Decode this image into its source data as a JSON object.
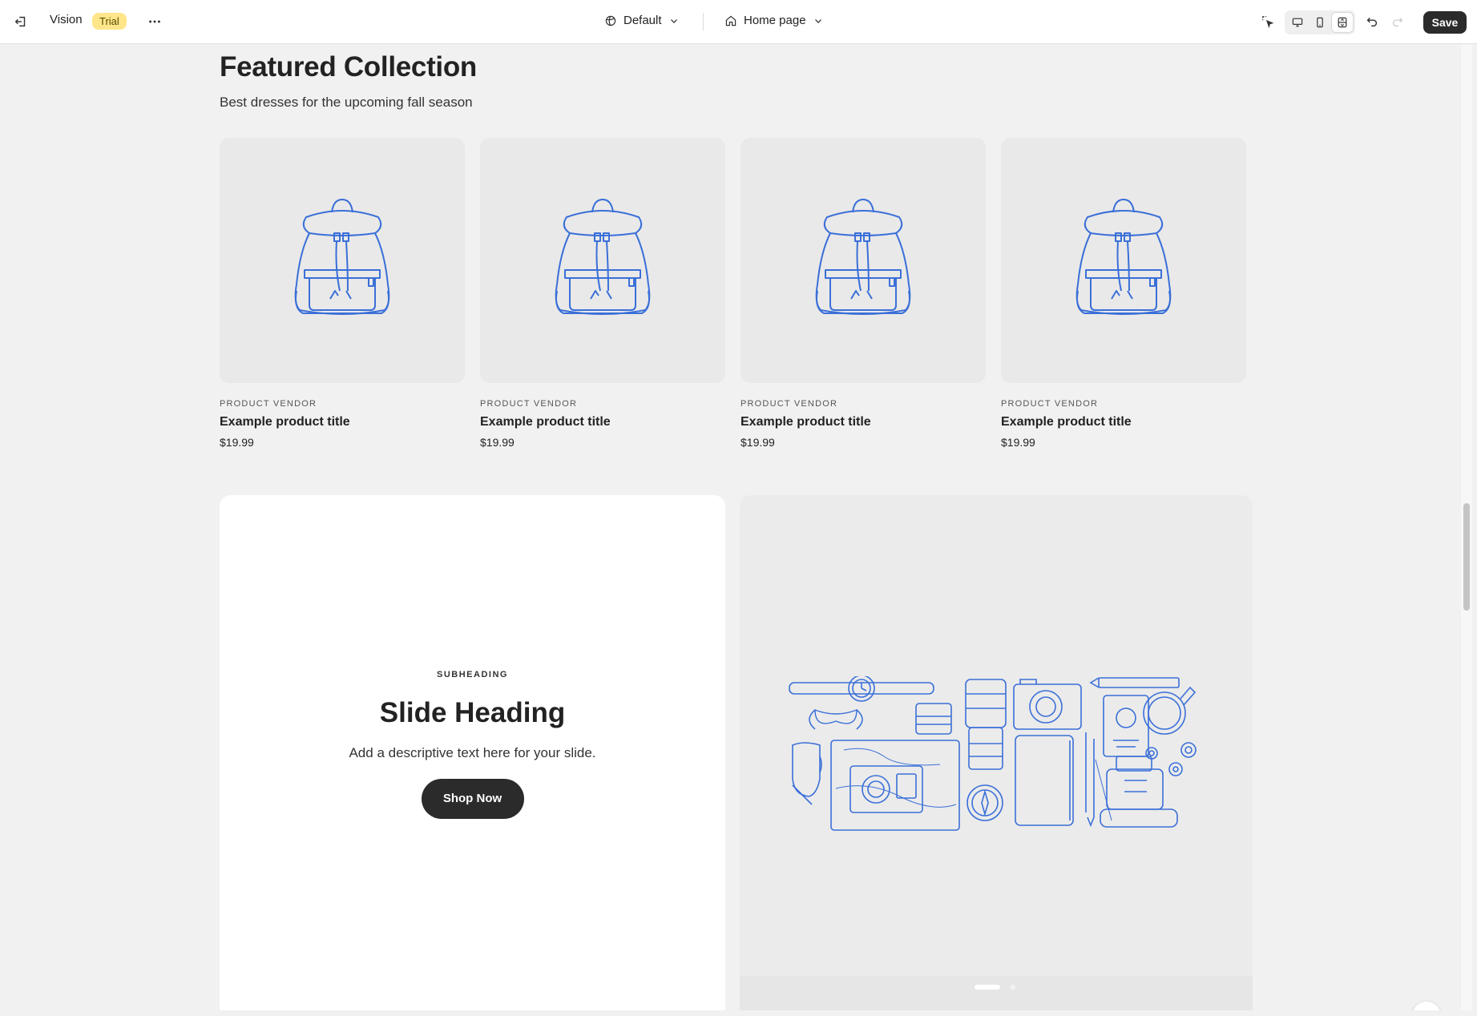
{
  "topbar": {
    "store_name": "Vision",
    "badge": "Trial",
    "theme_dropdown": "Default",
    "page_dropdown": "Home page",
    "save_label": "Save"
  },
  "featured_collection": {
    "title": "Featured Collection",
    "subtitle": "Best dresses for the upcoming fall season",
    "products": [
      {
        "vendor": "PRODUCT VENDOR",
        "title": "Example product title",
        "price": "$19.99"
      },
      {
        "vendor": "PRODUCT VENDOR",
        "title": "Example product title",
        "price": "$19.99"
      },
      {
        "vendor": "PRODUCT VENDOR",
        "title": "Example product title",
        "price": "$19.99"
      },
      {
        "vendor": "PRODUCT VENDOR",
        "title": "Example product title",
        "price": "$19.99"
      }
    ]
  },
  "slideshow": {
    "subheading": "SUBHEADING",
    "heading": "Slide Heading",
    "text": "Add a descriptive text here for your slide.",
    "button_label": "Shop Now"
  },
  "colors": {
    "illustration_blue": "#3a6fd8",
    "save_button_bg": "#2b2b2b",
    "trial_badge_bg": "#ffe68a"
  }
}
